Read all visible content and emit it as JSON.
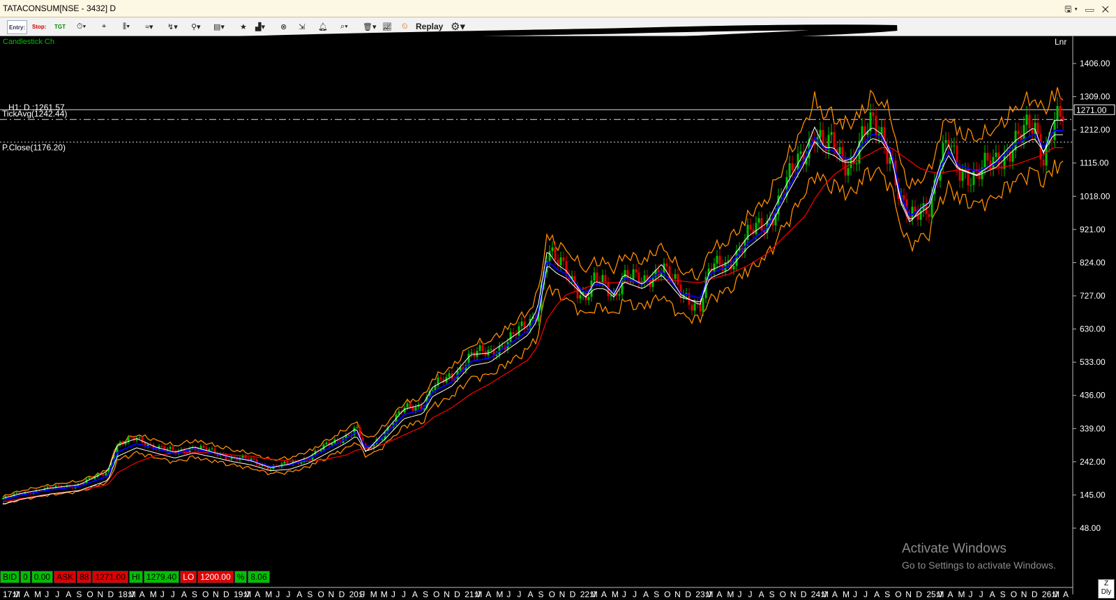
{
  "window": {
    "title": "TATACONSUM[NSE - 3432] D"
  },
  "toolbar": {
    "entry_label": "Entry:",
    "stop_label": "Stop:",
    "tgt_label": "TGT",
    "replay_label": "Replay",
    "icons": [
      "clock-icon",
      "crosshair-icon",
      "candle-type-icon",
      "pattern-icon",
      "draw-icon",
      "link-icon",
      "book-icon",
      "star-icon",
      "indicator-icon",
      "shuffle-icon",
      "cursor-icon",
      "alert-icon",
      "search-icon",
      "trash-icon",
      "line-chart-icon",
      "replay-icon",
      "gear-icon"
    ]
  },
  "overlay_labels": {
    "top_left": "Candlestick Ch",
    "scale_mode": "Lnr",
    "h1": "H1: D :1261.57",
    "tickavg": "TickAvg(1242.44)",
    "pclose": "P.Close(1176.20)",
    "last_price_tag": "1271.00"
  },
  "quote_bar": {
    "bid_label": "BID",
    "bid_qty": "0",
    "bid_price": "0.00",
    "ask_label": "ASK",
    "ask_qty": "88",
    "ask_price": "1271.00",
    "hi_label": "HI",
    "hi_value": "1279.40",
    "lo_label": "LO",
    "lo_value": "1200.00",
    "pct_label": "%",
    "pct_value": "8.06"
  },
  "watermark": {
    "line1": "Activate Windows",
    "line2": "Go to Settings to activate Windows."
  },
  "corner_box": {
    "top": "Z",
    "bottom": "Dly"
  },
  "colors": {
    "background": "#000000",
    "up": "#00c000",
    "down": "#e00000",
    "band": "#ff8c00",
    "ma_fast": "#ffffff",
    "ma_mid": "#0000ff",
    "ma_slow": "#ff0000",
    "axis_text": "#ffffff"
  },
  "chart_data": {
    "type": "line",
    "symbol": "TATACONSUM",
    "exchange": "NSE",
    "interval": "D",
    "yaxis_ticks": [
      "1406.00",
      "1309.00",
      "1212.00",
      "1115.00",
      "1018.00",
      "921.00",
      "824.00",
      "727.00",
      "630.00",
      "533.00",
      "436.00",
      "339.00",
      "242.00",
      "145.00",
      "48.00"
    ],
    "ylim": [
      0,
      1480
    ],
    "xaxis_ticks": [
      "17:J",
      "M",
      "A",
      "M",
      "J",
      "J",
      "A",
      "S",
      "O",
      "N",
      "D",
      "18:J",
      "M",
      "A",
      "M",
      "J",
      "J",
      "A",
      "S",
      "O",
      "N",
      "D",
      "19:J",
      "M",
      "A",
      "M",
      "J",
      "J",
      "A",
      "S",
      "O",
      "N",
      "D",
      "20:J",
      "F",
      "M",
      "M",
      "J",
      "J",
      "A",
      "S",
      "O",
      "N",
      "D",
      "21:J",
      "M",
      "A",
      "M",
      "J",
      "J",
      "A",
      "S",
      "O",
      "N",
      "D",
      "22:J",
      "M",
      "A",
      "M",
      "J",
      "J",
      "A",
      "S",
      "O",
      "N",
      "D",
      "23:J",
      "M",
      "A",
      "M",
      "J",
      "J",
      "A",
      "S",
      "O",
      "N",
      "D",
      "24:J",
      "M",
      "A",
      "M",
      "J",
      "J",
      "A",
      "S",
      "O",
      "N",
      "D",
      "25:J",
      "M",
      "A",
      "M",
      "J",
      "J",
      "A",
      "S",
      "O",
      "N",
      "D",
      "26:J",
      "M",
      "A"
    ],
    "x": [
      "2017-01",
      "2017-03",
      "2017-06",
      "2017-09",
      "2017-12",
      "2018-01",
      "2018-03",
      "2018-05",
      "2018-07",
      "2018-09",
      "2018-11",
      "2019-01",
      "2019-03",
      "2019-05",
      "2019-07",
      "2019-09",
      "2019-11",
      "2020-01",
      "2020-02",
      "2020-03",
      "2020-04",
      "2020-05",
      "2020-07",
      "2020-09",
      "2020-10",
      "2020-12",
      "2021-02",
      "2021-04",
      "2021-06",
      "2021-08",
      "2021-09",
      "2021-10",
      "2021-11",
      "2021-12",
      "2022-02",
      "2022-03",
      "2022-04",
      "2022-05",
      "2022-06",
      "2022-08",
      "2022-10",
      "2022-12",
      "2023-02",
      "2023-03",
      "2023-05",
      "2023-07",
      "2023-09",
      "2023-11",
      "2024-01",
      "2024-02",
      "2024-03",
      "2024-04",
      "2024-05",
      "2024-06",
      "2024-07",
      "2024-08",
      "2024-09",
      "2024-10",
      "2024-11",
      "2024-12",
      "2025-01",
      "2025-02",
      "2025-03",
      "2025-04",
      "2025-05",
      "2025-07",
      "2025-09",
      "2025-11",
      "2026-01",
      "2026-02",
      "2026-03"
    ],
    "series": [
      {
        "values": [
          135,
          150,
          165,
          175,
          215,
          290,
          310,
          285,
          270,
          285,
          270,
          255,
          245,
          225,
          235,
          255,
          290,
          320,
          340,
          270,
          300,
          330,
          395,
          410,
          460,
          490,
          555,
          560,
          600,
          640,
          690,
          860,
          820,
          800,
          720,
          770,
          760,
          730,
          790,
          760,
          820,
          730,
          700,
          800,
          825,
          900,
          940,
          1050,
          1150,
          1220,
          1160,
          1160,
          1120,
          1130,
          1190,
          1220,
          1200,
          1140,
          1000,
          940,
          980,
          1000,
          1100,
          1170,
          1100,
          1080,
          1120,
          1180,
          1220,
          1140,
          1240
        ]
      },
      {
        "values": [
          130,
          145,
          160,
          170,
          200,
          270,
          295,
          280,
          265,
          280,
          268,
          255,
          245,
          228,
          232,
          250,
          280,
          310,
          330,
          285,
          295,
          320,
          380,
          395,
          445,
          475,
          535,
          545,
          585,
          625,
          670,
          830,
          805,
          790,
          735,
          760,
          760,
          735,
          780,
          760,
          800,
          735,
          720,
          790,
          815,
          880,
          925,
          1030,
          1130,
          1190,
          1160,
          1150,
          1130,
          1130,
          1170,
          1200,
          1190,
          1150,
          1020,
          960,
          980,
          1000,
          1090,
          1150,
          1110,
          1090,
          1115,
          1170,
          1200,
          1160,
          1210
        ]
      },
      {
        "values": [
          125,
          135,
          148,
          158,
          175,
          210,
          240,
          260,
          268,
          270,
          268,
          262,
          258,
          250,
          244,
          243,
          250,
          262,
          276,
          280,
          285,
          295,
          320,
          345,
          370,
          400,
          440,
          470,
          505,
          540,
          580,
          660,
          700,
          730,
          750,
          760,
          765,
          765,
          768,
          768,
          775,
          770,
          765,
          775,
          790,
          815,
          850,
          905,
          960,
          1010,
          1050,
          1080,
          1100,
          1115,
          1130,
          1145,
          1160,
          1160,
          1140,
          1120,
          1100,
          1090,
          1085,
          1090,
          1095,
          1095,
          1100,
          1110,
          1130,
          1140,
          1160
        ]
      }
    ],
    "reference_lines": {
      "h1": 1261.57,
      "tickavg": 1242.44,
      "pclose": 1176.2,
      "last": 1271.0
    },
    "grid": false,
    "legend": "none"
  }
}
